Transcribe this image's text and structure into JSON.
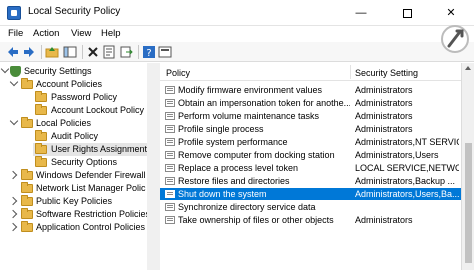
{
  "window": {
    "title": "Local Security Policy",
    "minimize_glyph": "—",
    "close_glyph": "✕"
  },
  "menu": [
    "File",
    "Action",
    "View",
    "Help"
  ],
  "tree": [
    {
      "label": "Security Settings",
      "level": 0,
      "expanded": true,
      "icon": "shield-icon"
    },
    {
      "label": "Account Policies",
      "level": 1,
      "expanded": true,
      "icon": "folder-icon"
    },
    {
      "label": "Password Policy",
      "level": 2,
      "icon": "folder-icon"
    },
    {
      "label": "Account Lockout Policy",
      "level": 2,
      "icon": "folder-icon"
    },
    {
      "label": "Local Policies",
      "level": 1,
      "expanded": true,
      "icon": "folder-icon"
    },
    {
      "label": "Audit Policy",
      "level": 2,
      "icon": "folder-icon"
    },
    {
      "label": "User Rights Assignment",
      "level": 2,
      "icon": "folder-icon",
      "selected": true
    },
    {
      "label": "Security Options",
      "level": 2,
      "icon": "folder-icon"
    },
    {
      "label": "Windows Defender Firewall",
      "level": 1,
      "expanded": false,
      "icon": "folder-icon"
    },
    {
      "label": "Network List Manager Polic",
      "level": 1,
      "icon": "folder-icon"
    },
    {
      "label": "Public Key Policies",
      "level": 1,
      "expanded": false,
      "icon": "folder-icon"
    },
    {
      "label": "Software Restriction Policies",
      "level": 1,
      "expanded": false,
      "icon": "folder-icon"
    },
    {
      "label": "Application Control Policies",
      "level": 1,
      "expanded": false,
      "icon": "folder-icon"
    }
  ],
  "list": {
    "columns": [
      "Policy",
      "Security Setting"
    ],
    "rows": [
      {
        "policy": "Modify firmware environment values",
        "setting": "Administrators"
      },
      {
        "policy": "Obtain an impersonation token for anothe...",
        "setting": "Administrators"
      },
      {
        "policy": "Perform volume maintenance tasks",
        "setting": "Administrators"
      },
      {
        "policy": "Profile single process",
        "setting": "Administrators"
      },
      {
        "policy": "Profile system performance",
        "setting": "Administrators,NT SERVIC..."
      },
      {
        "policy": "Remove computer from docking station",
        "setting": "Administrators,Users"
      },
      {
        "policy": "Replace a process level token",
        "setting": "LOCAL SERVICE,NETWO..."
      },
      {
        "policy": "Restore files and directories",
        "setting": "Administrators,Backup ..."
      },
      {
        "policy": "Shut down the system",
        "setting": "Administrators,Users,Ba...",
        "selected": true
      },
      {
        "policy": "Synchronize directory service data",
        "setting": ""
      },
      {
        "policy": "Take ownership of files or other objects",
        "setting": "Administrators"
      }
    ]
  },
  "colors": {
    "selection": "#0078d7",
    "tree_selection": "#e5e5e5",
    "folder": "#e8b84a"
  }
}
